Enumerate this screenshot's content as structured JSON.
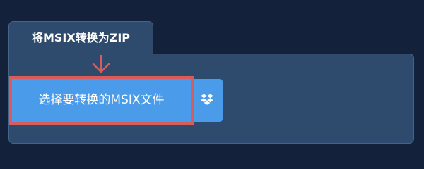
{
  "tab": {
    "title": "将MSIX转换为ZIP"
  },
  "upload": {
    "select_label": "选择要转换的MSIX文件",
    "dropbox_icon": "dropbox-icon"
  },
  "annotation": {
    "arrow_color": "#d95c5c",
    "highlight_color": "#d95c5c"
  },
  "colors": {
    "background": "#13223a",
    "panel": "#2e4a6c",
    "button": "#4a9bea"
  }
}
